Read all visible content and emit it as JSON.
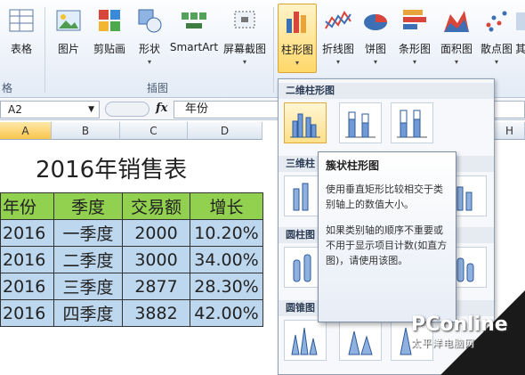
{
  "ribbon": {
    "buttons": [
      {
        "label": "表格",
        "icon": "table-icon"
      },
      {
        "label": "图片",
        "icon": "picture-icon"
      },
      {
        "label": "剪贴画",
        "icon": "clipart-icon"
      },
      {
        "label": "形状",
        "icon": "shapes-icon"
      },
      {
        "label": "SmartArt",
        "icon": "smartart-icon"
      },
      {
        "label": "屏幕截图",
        "icon": "screenshot-icon"
      },
      {
        "label": "柱形图",
        "icon": "column-chart-icon"
      },
      {
        "label": "折线图",
        "icon": "line-chart-icon"
      },
      {
        "label": "饼图",
        "icon": "pie-chart-icon"
      },
      {
        "label": "条形图",
        "icon": "bar-chart-icon"
      },
      {
        "label": "面积图",
        "icon": "area-chart-icon"
      },
      {
        "label": "散点图",
        "icon": "scatter-chart-icon"
      },
      {
        "label": "其",
        "icon": "other-charts-icon"
      }
    ],
    "groups": {
      "tables_tail": "格",
      "illustrations": "插图"
    }
  },
  "formula_bar": {
    "cell_ref": "A2",
    "fx": "fx",
    "content": "年份"
  },
  "columns": [
    "A",
    "B",
    "C",
    "D",
    "H"
  ],
  "sheet": {
    "title": "2016年销售表",
    "headers": [
      "年份",
      "季度",
      "交易额",
      "增长"
    ],
    "rows": [
      [
        "2016",
        "一季度",
        "2000",
        "10.20%"
      ],
      [
        "2016",
        "二季度",
        "3000",
        "34.00%"
      ],
      [
        "2016",
        "三季度",
        "2877",
        "28.30%"
      ],
      [
        "2016",
        "四季度",
        "3882",
        "42.00%"
      ]
    ]
  },
  "chart_menu": {
    "sections": [
      "二维柱形图",
      "三维柱",
      "圆柱图",
      "圆锥图"
    ]
  },
  "tooltip": {
    "title": "簇状柱形图",
    "p1": "使用垂直矩形比较相交于类别轴上的数值大小。",
    "p2": "如果类别轴的顺序不重要或不用于显示项目计数(如直方图)，请使用该图。"
  },
  "watermark": {
    "logo": "PConline",
    "sub": "太平洋电脑网"
  },
  "colors": {
    "header_green": "#92d050",
    "row_blue": "#bdd7ee",
    "highlight": "#ffd86a"
  }
}
